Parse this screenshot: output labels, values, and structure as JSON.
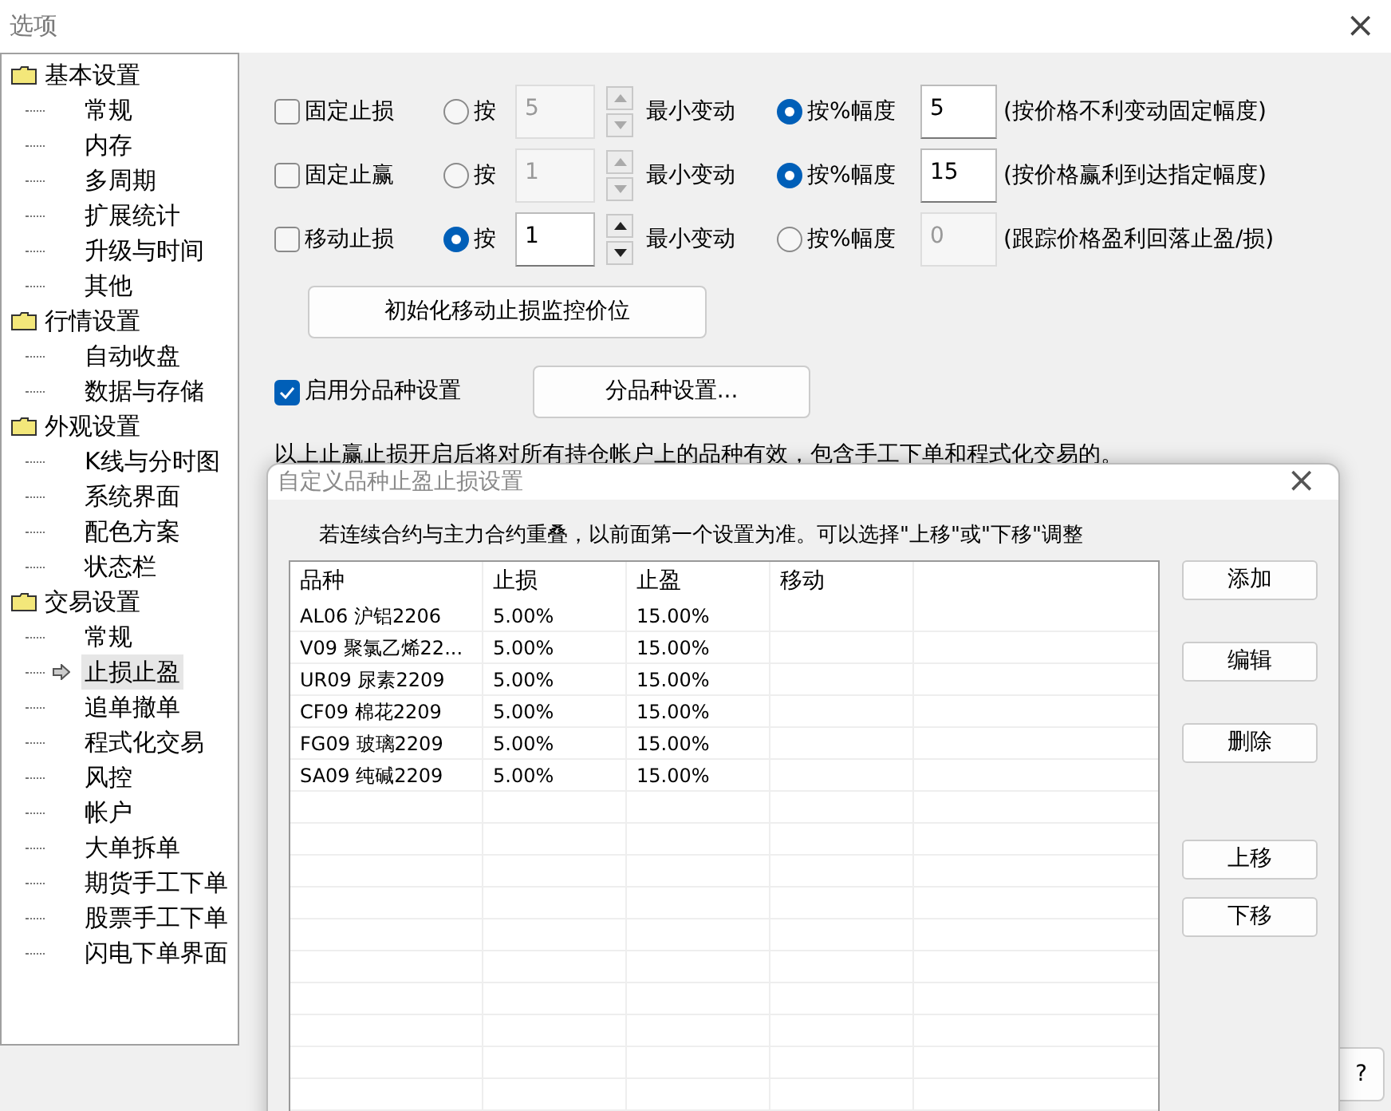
{
  "window": {
    "title": "选项",
    "close": "×"
  },
  "tree": [
    {
      "label": "基本设置",
      "children": [
        {
          "label": "常规",
          "selected": false
        },
        {
          "label": "内存",
          "selected": false
        },
        {
          "label": "多周期",
          "selected": false
        },
        {
          "label": "扩展统计",
          "selected": false
        },
        {
          "label": "升级与时间",
          "selected": false
        },
        {
          "label": "其他",
          "selected": false
        }
      ]
    },
    {
      "label": "行情设置",
      "children": [
        {
          "label": "自动收盘",
          "selected": false
        },
        {
          "label": "数据与存储",
          "selected": false
        }
      ]
    },
    {
      "label": "外观设置",
      "children": [
        {
          "label": "K线与分时图",
          "selected": false
        },
        {
          "label": "系统界面",
          "selected": false
        },
        {
          "label": "配色方案",
          "selected": false
        },
        {
          "label": "状态栏",
          "selected": false
        }
      ]
    },
    {
      "label": "交易设置",
      "children": [
        {
          "label": "常规",
          "selected": false
        },
        {
          "label": "止损止盈",
          "selected": true
        },
        {
          "label": "追单撤单",
          "selected": false
        },
        {
          "label": "程式化交易",
          "selected": false
        },
        {
          "label": "风控",
          "selected": false
        },
        {
          "label": "帐户",
          "selected": false
        },
        {
          "label": "大单拆单",
          "selected": false
        },
        {
          "label": "期货手工下单",
          "selected": false
        },
        {
          "label": "股票手工下单",
          "selected": false
        },
        {
          "label": "闪电下单界面",
          "selected": false
        }
      ]
    }
  ],
  "rules": [
    {
      "label": "固定止损",
      "checked": false,
      "options": [
        {
          "kind": "tick",
          "label": "按",
          "selected": false,
          "value": "5",
          "unit": "最小变动"
        },
        {
          "kind": "percent",
          "label": "按%幅度",
          "selected": true,
          "value": "5"
        }
      ],
      "note": "(按价格不利变动固定幅度)"
    },
    {
      "label": "固定止赢",
      "checked": false,
      "options": [
        {
          "kind": "tick",
          "label": "按",
          "selected": false,
          "value": "1",
          "unit": "最小变动"
        },
        {
          "kind": "percent",
          "label": "按%幅度",
          "selected": true,
          "value": "15"
        }
      ],
      "note": "(按价格赢利到达指定幅度)"
    },
    {
      "label": "移动止损",
      "checked": false,
      "options": [
        {
          "kind": "tick",
          "label": "按",
          "selected": true,
          "value": "1",
          "unit": "最小变动"
        },
        {
          "kind": "percent",
          "label": "按%幅度",
          "selected": false,
          "value": "0"
        }
      ],
      "note": "(跟踪价格盈利回落止盈/损)"
    }
  ],
  "init_button": "初始化移动止损监控价位",
  "per_product": {
    "label": "启用分品种设置",
    "checked": true,
    "button": "分品种设置..."
  },
  "info": "以上止赢止损开启后将对所有持仓帐户上的品种有效，包含手工下单和程式化交易的。",
  "help_button": "?",
  "dialog": {
    "title": "自定义品种止盈止损设置",
    "close": "×",
    "hint": "若连续合约与主力合约重叠，以前面第一个设置为准。可以选择\"上移\"或\"下移\"调整",
    "table": {
      "columns": [
        "品种",
        "止损",
        "止盈",
        "移动"
      ],
      "rows": [
        [
          "AL06 沪铝2206",
          "5.00%",
          "15.00%",
          ""
        ],
        [
          "V09 聚氯乙烯22...",
          "5.00%",
          "15.00%",
          ""
        ],
        [
          "UR09 尿素2209",
          "5.00%",
          "15.00%",
          ""
        ],
        [
          "CF09 棉花2209",
          "5.00%",
          "15.00%",
          ""
        ],
        [
          "FG09 玻璃2209",
          "5.00%",
          "15.00%",
          ""
        ],
        [
          "SA09 纯碱2209",
          "5.00%",
          "15.00%",
          ""
        ]
      ]
    },
    "buttons": [
      "添加",
      "编辑",
      "删除",
      "上移",
      "下移"
    ]
  }
}
